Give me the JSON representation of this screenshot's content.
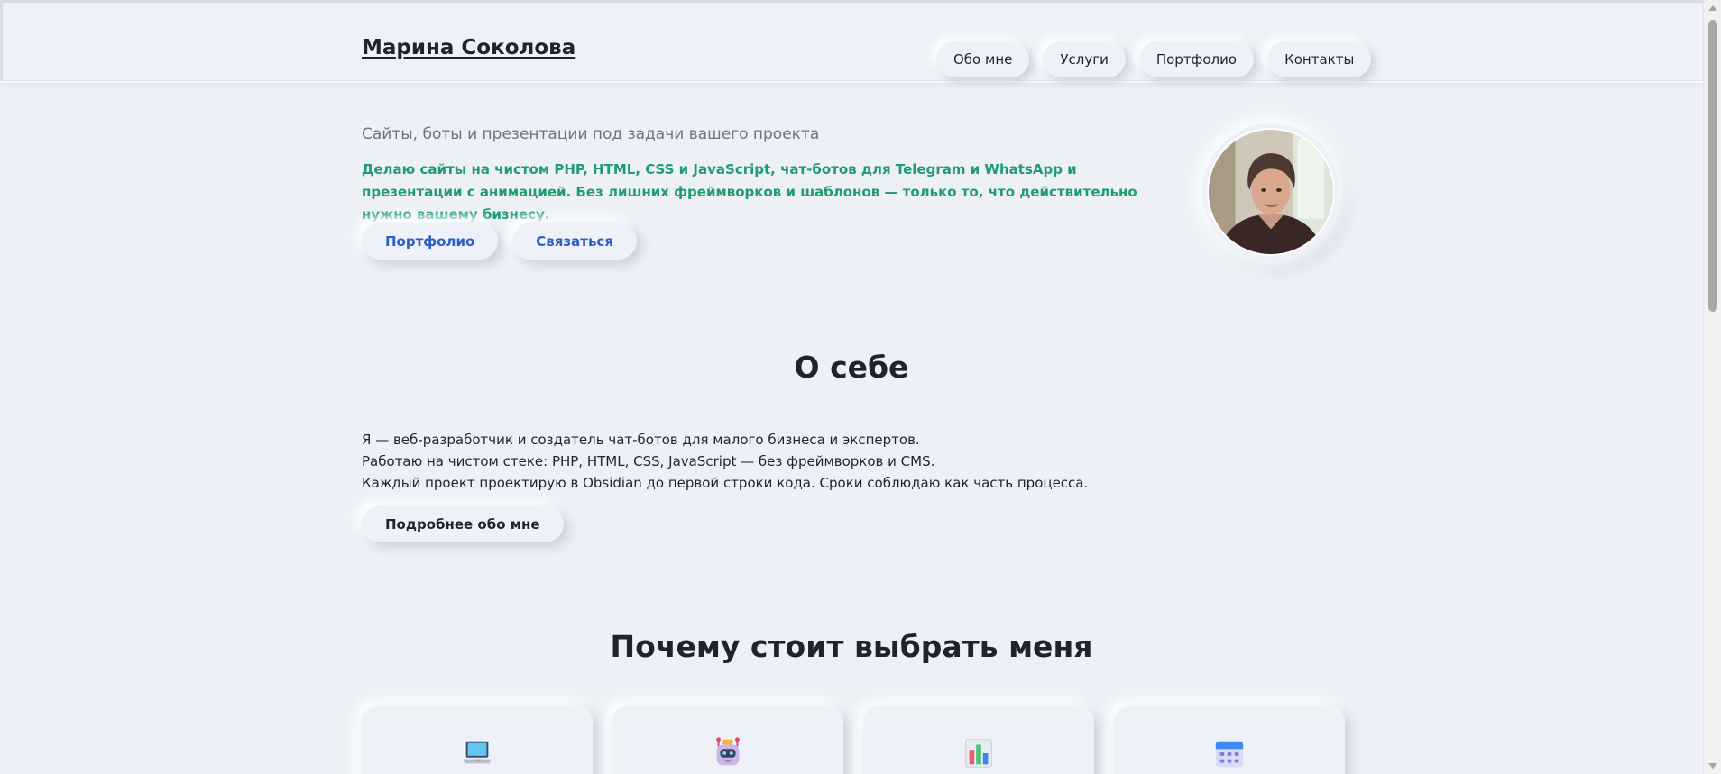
{
  "header": {
    "brand": "Марина Соколова",
    "nav": [
      "Обо мне",
      "Услуги",
      "Портфолио",
      "Контакты"
    ]
  },
  "hero": {
    "subtitle": "Сайты, боты и презентации под задачи вашего проекта",
    "lead": "Делаю сайты на чистом PHP, HTML, CSS и JavaScript, чат-ботов для Telegram и WhatsApp и презентации с анимацией. Без лишних фреймворков и шаблонов — только то, что действительно нужно вашему бизнесу.",
    "buttons": [
      "Портфолио",
      "Связаться"
    ]
  },
  "about": {
    "title": "О себе",
    "lines": [
      "Я — веб-разработчик и создатель чат-ботов для малого бизнеса и экспертов.",
      "Работаю на чистом стеке: PHP, HTML, CSS, JavaScript — без фреймворков и CMS.",
      "Каждый проект проектирую в Obsidian до первой строки кода. Сроки соблюдаю как часть процесса."
    ],
    "button": "Подробнее обо мне"
  },
  "why": {
    "title": "Почему стоит выбрать меня",
    "card_icons": [
      "laptop-icon",
      "robot-icon",
      "bar-chart-icon",
      "calendar-icon"
    ]
  },
  "colors": {
    "background": "#edf1f7",
    "accent_green": "#1f9d6e",
    "accent_blue": "#2d5ec9",
    "text": "#1d2430"
  }
}
